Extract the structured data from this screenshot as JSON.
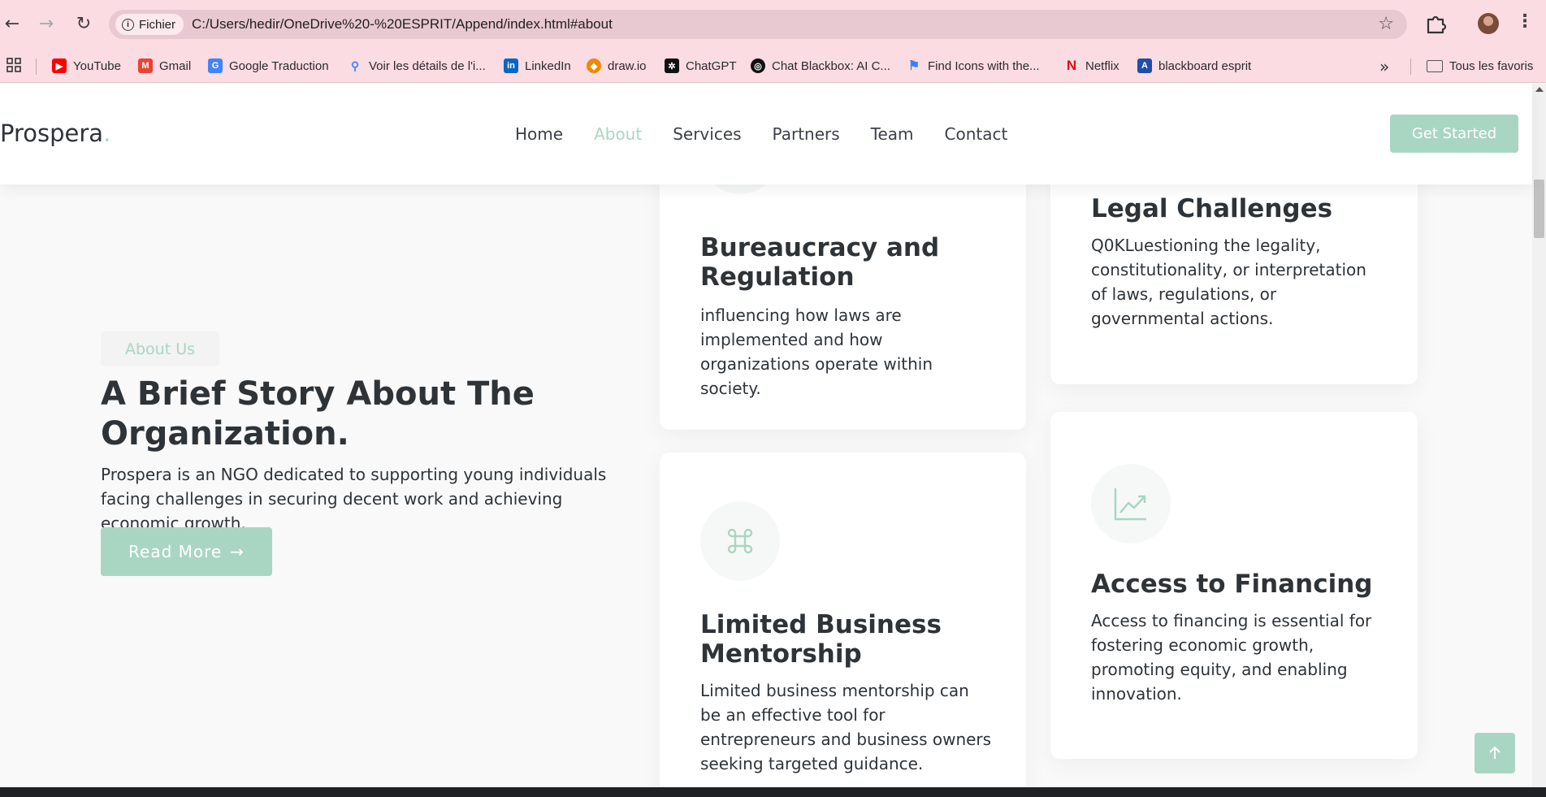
{
  "browser": {
    "site_chip": "Fichier",
    "url": "C:/Users/hedir/OneDrive%20-%20ESPRIT/Append/index.html#about",
    "bookmarks": [
      {
        "label": "YouTube",
        "icon": "youtube-icon",
        "color": "#ff0000"
      },
      {
        "label": "Gmail",
        "icon": "gmail-icon",
        "color": "#ea4335"
      },
      {
        "label": "Google Traduction",
        "icon": "google-translate-icon",
        "color": "#4285f4"
      },
      {
        "label": "Voir les détails de l'i...",
        "icon": "search-icon",
        "color": "#4285f4"
      },
      {
        "label": "LinkedIn",
        "icon": "linkedin-icon",
        "color": "#0a66c2"
      },
      {
        "label": "draw.io",
        "icon": "drawio-icon",
        "color": "#f08705"
      },
      {
        "label": "ChatGPT",
        "icon": "chatgpt-icon",
        "color": "#111111"
      },
      {
        "label": "Chat Blackbox: AI C...",
        "icon": "blackbox-icon",
        "color": "#111111"
      },
      {
        "label": "Find Icons with the...",
        "icon": "flag-icon",
        "color": "#3b82f6"
      },
      {
        "label": "Netflix",
        "icon": "netflix-icon",
        "color": "#e50914"
      },
      {
        "label": "blackboard esprit",
        "icon": "blackboard-icon",
        "color": "#1f4ea8"
      }
    ],
    "all_bookmarks": "Tous les favoris"
  },
  "header": {
    "logo": "Prospera",
    "logo_dot": ".",
    "menu": [
      "Home",
      "About",
      "Services",
      "Partners",
      "Team",
      "Contact"
    ],
    "active": "About",
    "cta": "Get Started"
  },
  "about": {
    "pill": "About Us",
    "title": "A Brief Story About The Organization.",
    "text": "Prospera is an NGO dedicated to supporting young individuals facing challenges in securing decent work and achieving economic growth.",
    "button": "Read More"
  },
  "cards": [
    {
      "title": "Bureaucracy and Regulation",
      "text": "influencing how laws are implemented and how organizations operate within society.",
      "icon": "document-icon"
    },
    {
      "title": "Legal Challenges",
      "text": "Q0KLuestioning the legality, constitutionality, or interpretation of laws, regulations, or governmental actions.",
      "icon": "scale-icon"
    },
    {
      "title": "Limited Business Mentorship",
      "text": "Limited business mentorship can be an effective tool for entrepreneurs and business owners seeking targeted guidance.",
      "icon": "command-icon"
    },
    {
      "title": "Access to Financing",
      "text": "Access to financing is essential for fostering economic growth, promoting equity, and enabling innovation.",
      "icon": "trending-up-icon"
    }
  ],
  "colors": {
    "accent": "#a9d6c3",
    "browser_bar": "#fbdce3",
    "text": "#2e3338"
  }
}
